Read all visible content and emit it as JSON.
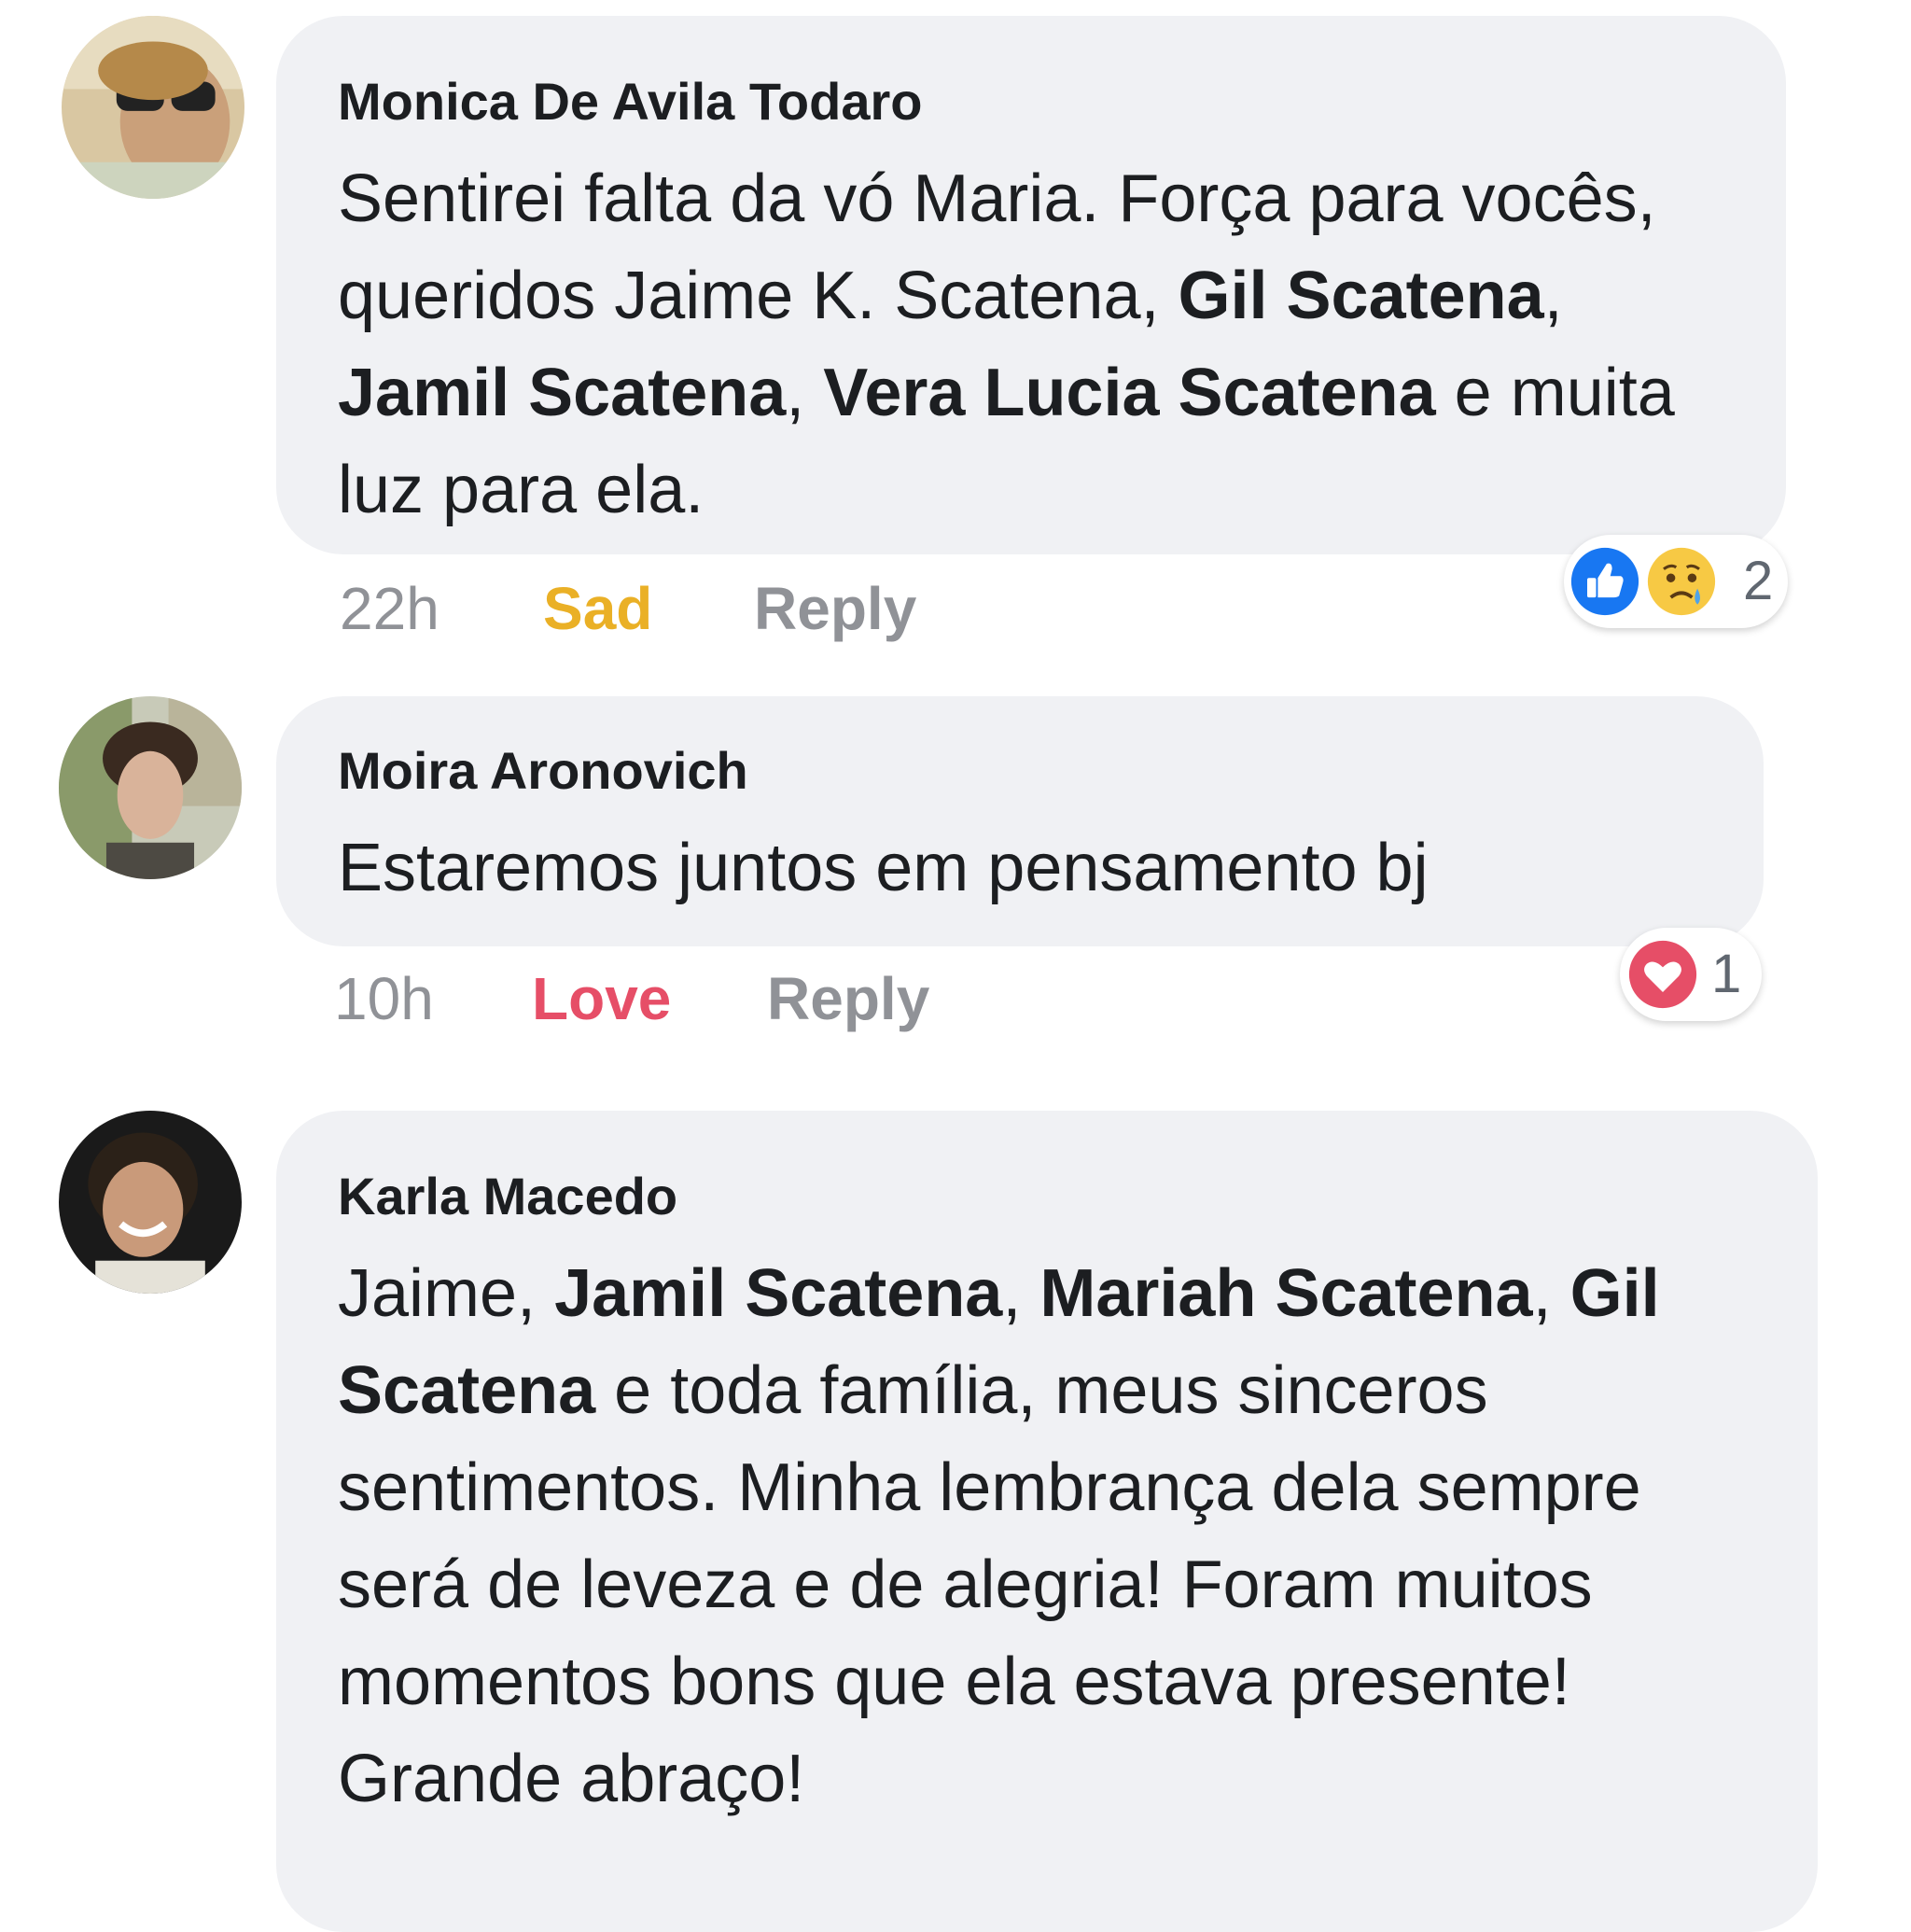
{
  "comments": [
    {
      "author": "Monica De Avila Todaro",
      "text_parts": [
        "Sentirei falta da vó Maria. Força para vocês, queridos Jaime K. Scatena, ",
        "Gil Scatena",
        ", ",
        "Jamil Scatena",
        ", ",
        "Vera Lucia Scatena",
        " e muita luz para ela."
      ],
      "time": "22h",
      "reaction_label": "Sad",
      "reply_label": "Reply",
      "reaction_count": "2",
      "reaction_icons": [
        "like-icon",
        "sad-face-icon"
      ]
    },
    {
      "author": "Moira Aronovich",
      "text": "Estaremos juntos em pensamento  bj",
      "time": "10h",
      "reaction_label": "Love",
      "reply_label": "Reply",
      "reaction_count": "1",
      "reaction_icons": [
        "heart-icon"
      ]
    },
    {
      "author": "Karla Macedo",
      "text_parts": [
        "Jaime, ",
        "Jamil Scatena",
        ", ",
        "Mariah Scatena",
        ", ",
        "Gil Scatena",
        " e toda família, meus sinceros sentimentos. Minha lembrança dela sempre será de leveza e de alegria!  Foram muitos momentos bons que ela estava presente!  Grande abraço!"
      ]
    }
  ],
  "colors": {
    "bubble": "#f0f1f4",
    "sad": "#eab026",
    "love": "#e64e67",
    "like": "#1877f2",
    "muted": "#909297"
  }
}
